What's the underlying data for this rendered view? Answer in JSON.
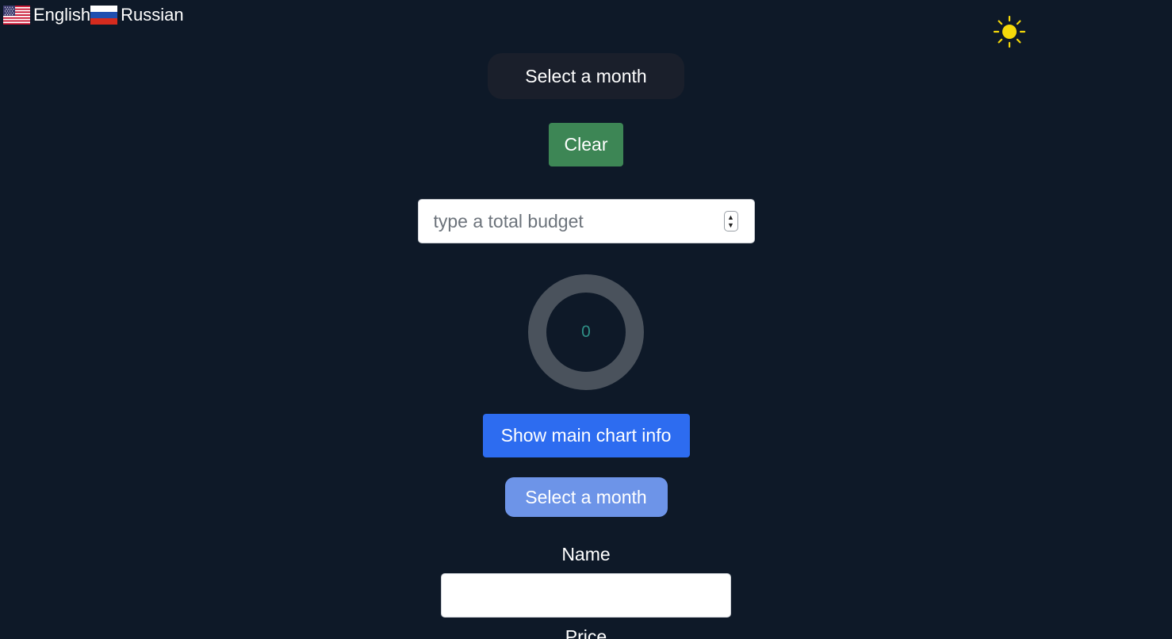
{
  "languages": [
    {
      "label": "English",
      "flag": "us-flag-icon"
    },
    {
      "label": "Russian",
      "flag": "ru-flag-icon"
    }
  ],
  "theme_toggle": {
    "icon": "sun-icon",
    "color": "#f5d90a"
  },
  "month_selector": {
    "label": "Select a month"
  },
  "clear_button": {
    "label": "Clear",
    "color": "#3d8655"
  },
  "budget": {
    "placeholder": "type a total budget",
    "value": ""
  },
  "donut": {
    "value": "0",
    "track_color": "#4a525c"
  },
  "show_chart_button": {
    "label": "Show main chart info",
    "color": "#2d6cf0"
  },
  "month_button": {
    "label": "Select a month",
    "color": "#6d94e8"
  },
  "form": {
    "name_label": "Name",
    "name_value": "",
    "price_label": "Price"
  },
  "colors": {
    "background": "#0e1928",
    "pill": "#1a1f2b"
  }
}
